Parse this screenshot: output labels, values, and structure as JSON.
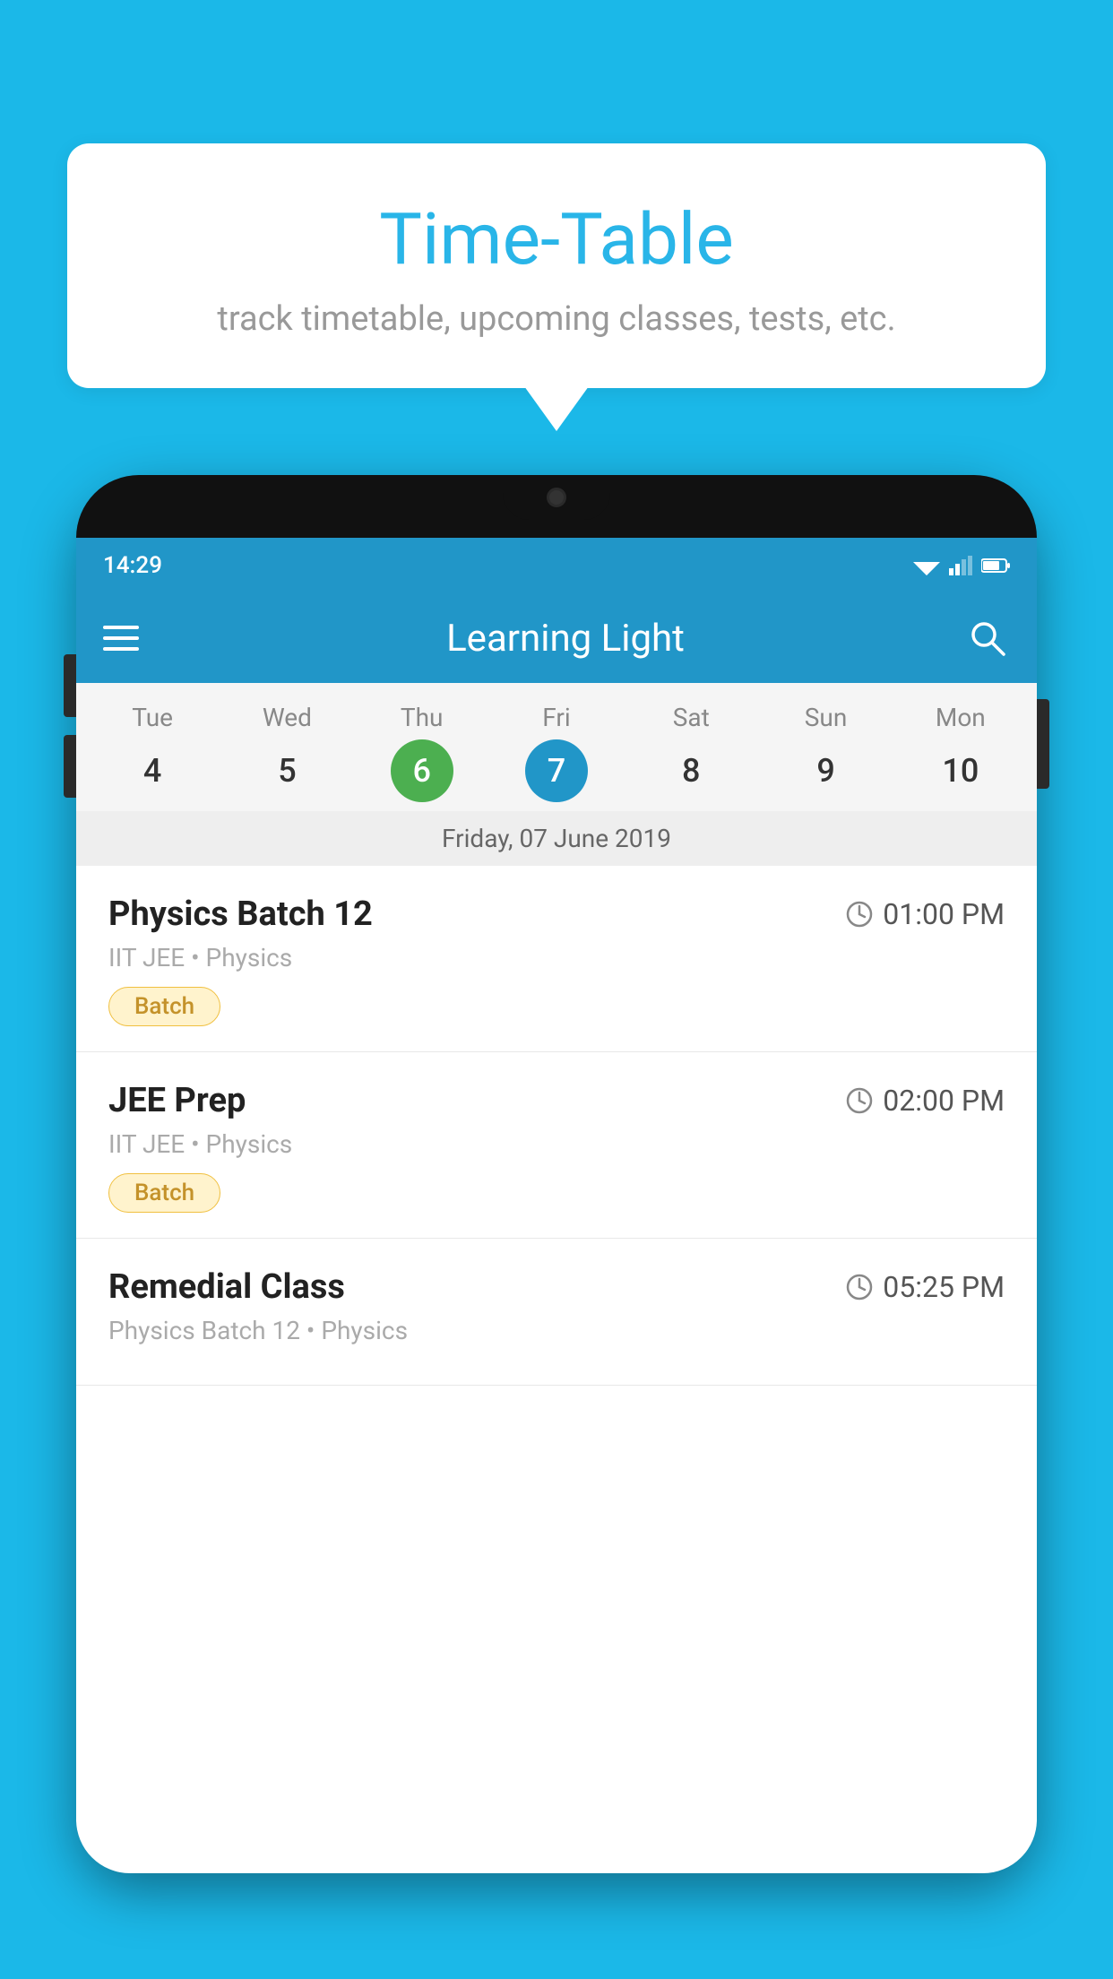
{
  "background_color": "#1bb8e8",
  "speech_bubble": {
    "title": "Time-Table",
    "subtitle": "track timetable, upcoming classes, tests, etc."
  },
  "phone": {
    "status_bar": {
      "time": "14:29",
      "signal_icons": "▾▴▐"
    },
    "app_bar": {
      "title": "Learning Light",
      "menu_icon": "hamburger",
      "search_icon": "search"
    },
    "calendar": {
      "days": [
        {
          "label": "Tue",
          "number": "4"
        },
        {
          "label": "Wed",
          "number": "5"
        },
        {
          "label": "Thu",
          "number": "6",
          "state": "today"
        },
        {
          "label": "Fri",
          "number": "7",
          "state": "selected"
        },
        {
          "label": "Sat",
          "number": "8"
        },
        {
          "label": "Sun",
          "number": "9"
        },
        {
          "label": "Mon",
          "number": "10"
        }
      ],
      "selected_date_label": "Friday, 07 June 2019"
    },
    "schedule": [
      {
        "title": "Physics Batch 12",
        "time": "01:00 PM",
        "subtitle": "IIT JEE • Physics",
        "badge": "Batch"
      },
      {
        "title": "JEE Prep",
        "time": "02:00 PM",
        "subtitle": "IIT JEE • Physics",
        "badge": "Batch"
      },
      {
        "title": "Remedial Class",
        "time": "05:25 PM",
        "subtitle": "Physics Batch 12 • Physics",
        "badge": ""
      }
    ]
  }
}
